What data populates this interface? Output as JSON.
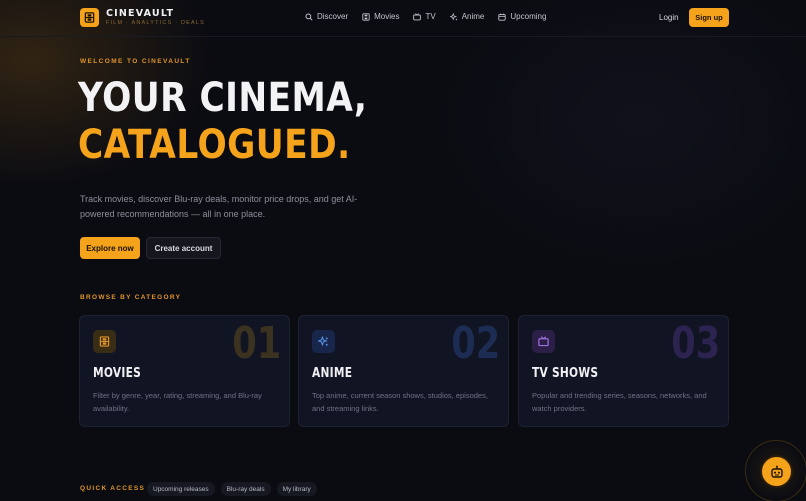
{
  "brand": {
    "name": "CINEVAULT",
    "tagline": "FILM · ANALYTICS · DEALS",
    "logo_icon": "film-icon"
  },
  "nav": {
    "items": [
      {
        "label": "Discover",
        "icon": "search-icon"
      },
      {
        "label": "Movies",
        "icon": "film-icon"
      },
      {
        "label": "TV",
        "icon": "tv-icon"
      },
      {
        "label": "Anime",
        "icon": "sparkle-icon"
      },
      {
        "label": "Upcoming",
        "icon": "calendar-icon"
      }
    ],
    "login_label": "Login",
    "signup_label": "Sign up"
  },
  "hero": {
    "eyebrow": "WELCOME TO CINEVAULT",
    "title_line1": "YOUR CINEMA,",
    "title_line2": "CATALOGUED.",
    "description": "Track movies, discover Blu-ray deals, monitor price drops, and get AI-powered recommendations — all in one place.",
    "primary_cta": "Explore now",
    "secondary_cta": "Create account"
  },
  "categories": {
    "label": "BROWSE BY CATEGORY",
    "items": [
      {
        "number": "01",
        "title": "MOVIES",
        "description": "Filter by genre, year, rating, streaming, and Blu-ray availability.",
        "icon": "film-icon",
        "accent": "#c98a1c"
      },
      {
        "number": "02",
        "title": "ANIME",
        "description": "Top anime, current season shows, studios, episodes, and streaming links.",
        "icon": "sparkle-icon",
        "accent": "#4f86d8"
      },
      {
        "number": "03",
        "title": "TV SHOWS",
        "description": "Popular and trending series, seasons, networks, and watch providers.",
        "icon": "tv-icon",
        "accent": "#8a56c9"
      }
    ]
  },
  "quick_access": {
    "label": "QUICK ACCESS",
    "chips": [
      "Upcoming releases",
      "Blu-ray deals",
      "My library"
    ]
  },
  "assistant": {
    "icon": "bot-icon"
  },
  "colors": {
    "accent": "#f5a31a",
    "background": "#0b0c12",
    "card": "#111523"
  }
}
